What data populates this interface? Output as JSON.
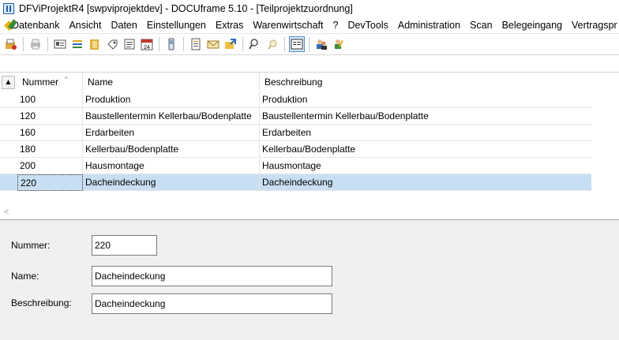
{
  "window": {
    "title": "DFViProjektR4 [swpviprojektdev] - DOCUframe 5.10 - [Teilprojektzuordnung]"
  },
  "menu": {
    "items": [
      "Datenbank",
      "Ansicht",
      "Daten",
      "Einstellungen",
      "Extras",
      "Warenwirtschaft",
      "?",
      "DevTools",
      "Administration",
      "Scan",
      "Belegeingang",
      "Vertragspr"
    ]
  },
  "toolbar": {
    "icons": [
      "open-icon",
      "print-icon",
      "card-icon",
      "list-icon",
      "folder-icon",
      "tag-icon",
      "notepad-icon",
      "calendar-icon",
      "phone-icon",
      "document-icon",
      "mail-icon",
      "export-icon",
      "search-icon",
      "search-disabled-icon",
      "form-view-icon",
      "users-icon",
      "user-edit-icon"
    ]
  },
  "grid": {
    "columns": [
      "Nummer",
      "Name",
      "Beschreibung"
    ],
    "rows": [
      {
        "nummer": "100",
        "name": "Produktion",
        "beschreibung": "Produktion"
      },
      {
        "nummer": "120",
        "name": "Baustellentermin Kellerbau/Bodenplatte",
        "beschreibung": "Baustellentermin Kellerbau/Bodenplatte"
      },
      {
        "nummer": "160",
        "name": "Erdarbeiten",
        "beschreibung": "Erdarbeiten"
      },
      {
        "nummer": "180",
        "name": "Kellerbau/Bodenplatte",
        "beschreibung": "Kellerbau/Bodenplatte"
      },
      {
        "nummer": "200",
        "name": "Hausmontage",
        "beschreibung": "Hausmontage"
      },
      {
        "nummer": "220",
        "name": "Dacheindeckung",
        "beschreibung": "Dacheindeckung"
      }
    ],
    "selected_index": 5
  },
  "detail": {
    "nummer_label": "Nummer:",
    "nummer_value": "220",
    "name_label": "Name:",
    "name_value": "Dacheindeckung",
    "beschreibung_label": "Beschreibung:",
    "beschreibung_value": "Dacheindeckung"
  }
}
